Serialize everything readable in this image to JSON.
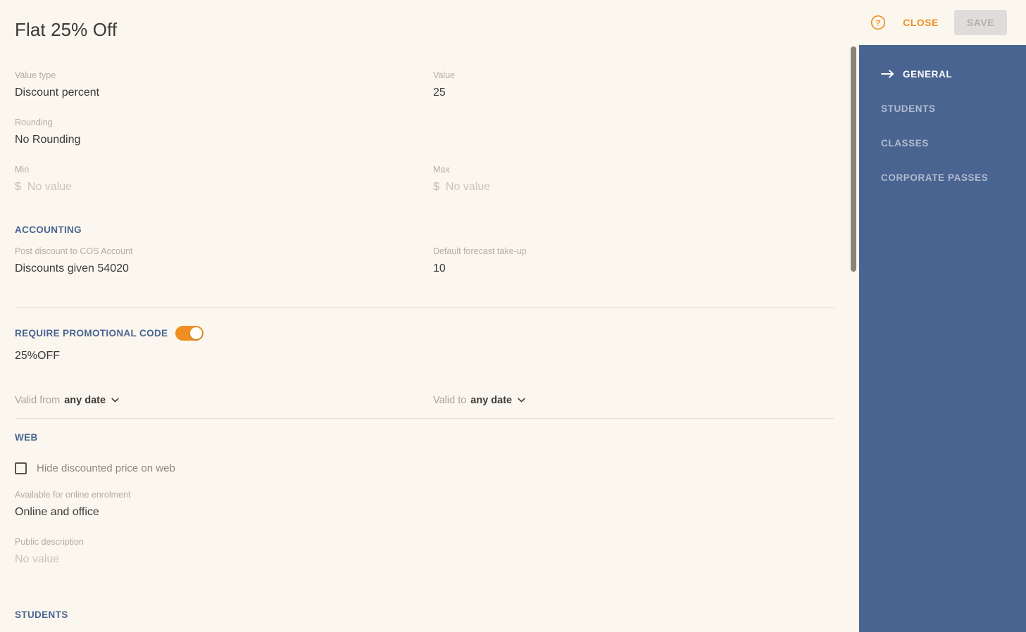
{
  "header": {
    "title": "Flat 25% Off",
    "help_icon": "help-circle-icon",
    "close_label": "CLOSE",
    "save_label": "SAVE"
  },
  "colors": {
    "background": "#fbf7ef",
    "accent_orange": "#ef8f22",
    "sidebar_blue": "#4a6491",
    "section_heading": "#4a6491",
    "label_grey": "#b3aca2",
    "value_dark": "#3a3a38",
    "save_disabled_bg": "#dedddb",
    "divider": "#e5ded2",
    "scrollbar": "#8a8377"
  },
  "general": {
    "value_type": {
      "label": "Value type",
      "value": "Discount percent"
    },
    "value": {
      "label": "Value",
      "value": "25"
    },
    "rounding": {
      "label": "Rounding",
      "value": "No Rounding"
    },
    "min": {
      "label": "Min",
      "currency": "$",
      "placeholder": "No value"
    },
    "max": {
      "label": "Max",
      "currency": "$",
      "placeholder": "No value"
    }
  },
  "accounting": {
    "heading": "ACCOUNTING",
    "cos_account": {
      "label": "Post discount to COS Account",
      "value": "Discounts given 54020"
    },
    "forecast": {
      "label": "Default forecast take-up",
      "value": "10"
    }
  },
  "promo": {
    "heading": "REQUIRE PROMOTIONAL CODE",
    "toggle_on": true,
    "code": "25%OFF",
    "valid_from": {
      "label": "Valid from",
      "value": "any date"
    },
    "valid_to": {
      "label": "Valid to",
      "value": "any date"
    }
  },
  "web": {
    "heading": "WEB",
    "hide_price": {
      "label": "Hide discounted price on web",
      "checked": false
    },
    "online_enrolment": {
      "label": "Available for online enrolment",
      "value": "Online and office"
    },
    "public_description": {
      "label": "Public description",
      "placeholder": "No value"
    }
  },
  "students_section": {
    "heading": "STUDENTS"
  },
  "sidebar": {
    "items": [
      {
        "label": "GENERAL",
        "active": true
      },
      {
        "label": "STUDENTS",
        "active": false
      },
      {
        "label": "CLASSES",
        "active": false
      },
      {
        "label": "CORPORATE PASSES",
        "active": false
      }
    ]
  }
}
